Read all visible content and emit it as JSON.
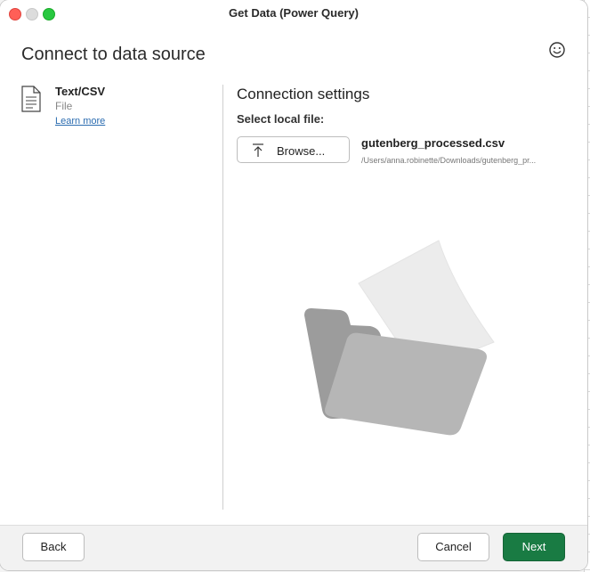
{
  "window": {
    "title": "Get Data (Power Query)"
  },
  "header": {
    "title": "Connect to data source",
    "feedback_icon": "smiley-icon"
  },
  "source": {
    "name": "Text/CSV",
    "type": "File",
    "learn_more": "Learn more",
    "icon": "document-icon"
  },
  "connection": {
    "title": "Connection settings",
    "select_label": "Select local file:",
    "browse_label": "Browse...",
    "file_name": "gutenberg_processed.csv",
    "file_path": "/Users/anna.robinette/Downloads/gutenberg_pr..."
  },
  "footer": {
    "back_label": "Back",
    "cancel_label": "Cancel",
    "next_label": "Next"
  },
  "colors": {
    "primary": "#197b43",
    "link": "#2b6cb0",
    "close": "#ff5f57",
    "maximize": "#28c840"
  }
}
